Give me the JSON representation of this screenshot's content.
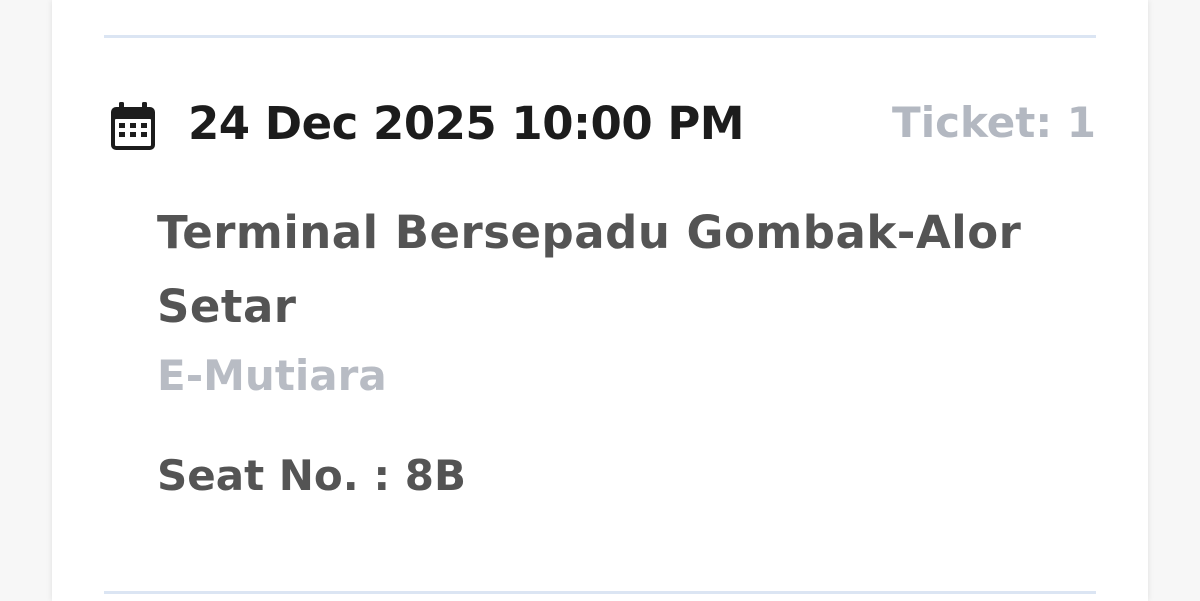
{
  "trip": {
    "datetime": "24 Dec 2025 10:00 PM",
    "ticket": "Ticket: 1",
    "route": "Terminal Bersepadu Gombak-Alor Setar",
    "operator": "E-Mutiara",
    "seat": "Seat No. : 8B"
  },
  "icons": {
    "date": "calendar-icon"
  },
  "colors": {
    "primary_text": "#1c1c1c",
    "secondary_text": "#545454",
    "muted_text": "#b8bcc4",
    "divider": "#dbe5f3"
  }
}
